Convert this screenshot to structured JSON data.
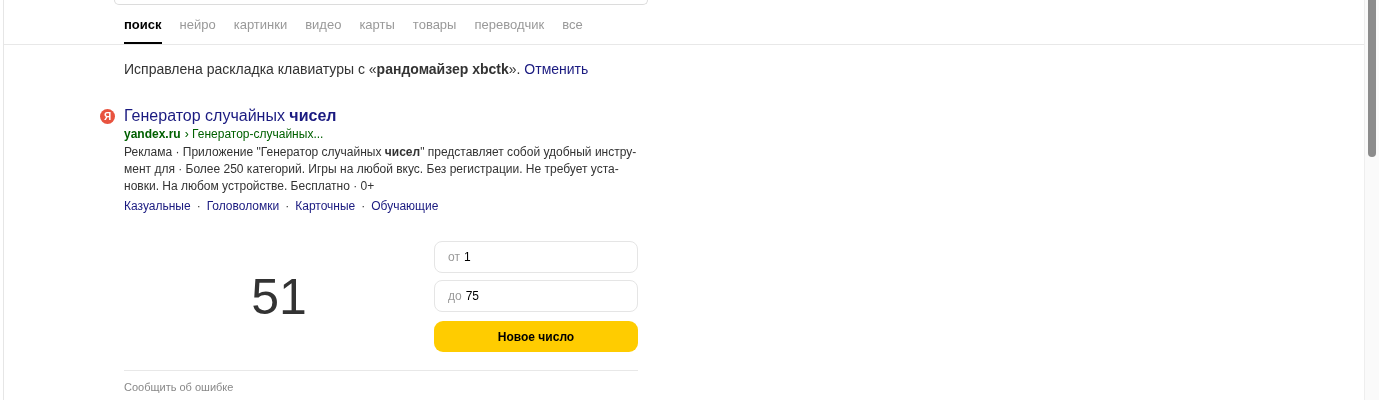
{
  "tabs": [
    {
      "label": "поиск",
      "selected": true
    },
    {
      "label": "нейро",
      "selected": false
    },
    {
      "label": "картинки",
      "selected": false
    },
    {
      "label": "видео",
      "selected": false
    },
    {
      "label": "карты",
      "selected": false
    },
    {
      "label": "товары",
      "selected": false
    },
    {
      "label": "переводчик",
      "selected": false
    },
    {
      "label": "все",
      "selected": false
    }
  ],
  "correction": {
    "text": "Исправлена раскладка клавиатуры с «**рандомайзер xbctk**».",
    "link": "Отменить"
  },
  "ad": {
    "favicon": "Я",
    "title": "Генератор случайных **чисел**",
    "domain": "yandex.ru",
    "path": "› Генератор-случайных...",
    "description_lines": [
      "Реклама · Приложение \"Генератор случайных **чисел**\" представляет собой удобный инстру-",
      "мент для · Более 250 категорий. Игры на любой вкус. Без регистрации. Не требует уста-",
      "новки. На любом устройстве. Бесплатно · 0+"
    ],
    "sitelinks": [
      "Казуальные",
      "Головоломки",
      "Карточные",
      "Обучающие"
    ],
    "sitelink_separators": [
      "·",
      "·",
      "·"
    ]
  },
  "generator": {
    "result": "51",
    "from": {
      "label": "от",
      "value": "1"
    },
    "to": {
      "label": "до",
      "value": "75"
    },
    "button": "Новое число"
  },
  "report": "Сообщить об ошибке"
}
